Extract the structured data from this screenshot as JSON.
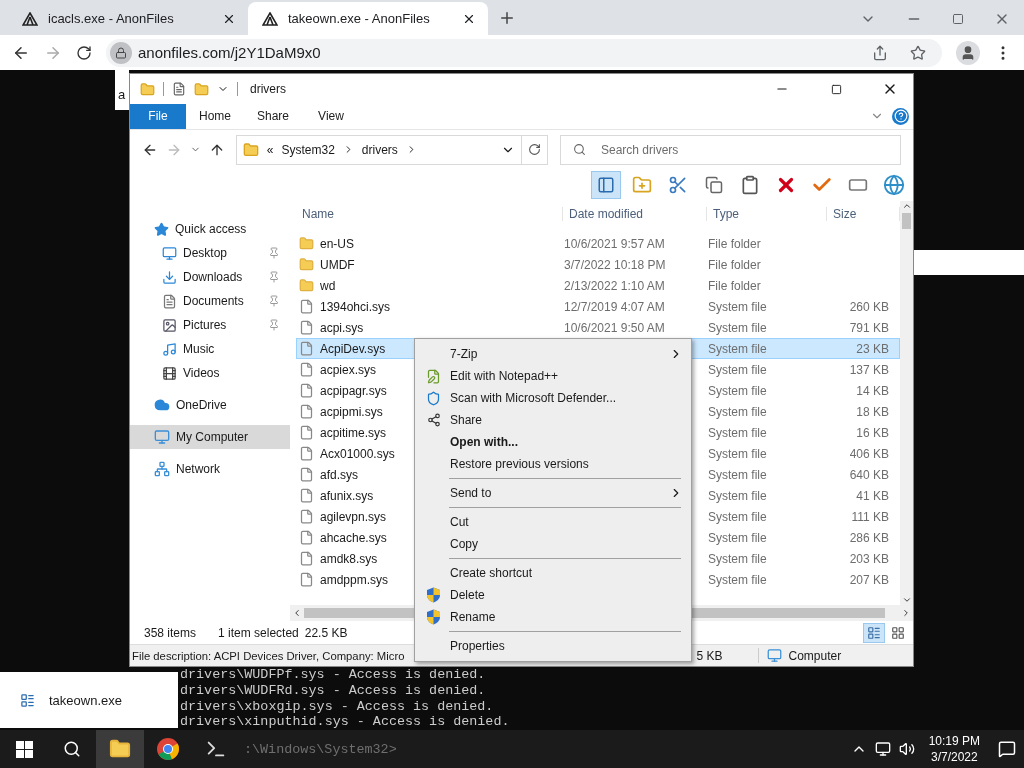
{
  "browser": {
    "tabs": [
      {
        "title": "icacls.exe - AnonFiles",
        "selected": false
      },
      {
        "title": "takeown.exe - AnonFiles",
        "selected": true
      }
    ],
    "url": "anonfiles.com/j2Y1DaM9x0"
  },
  "page_popup": {
    "text": "a"
  },
  "explorer": {
    "title": "drivers",
    "ribbon_tabs": [
      {
        "label": "File",
        "kind": "file"
      },
      {
        "label": "Home",
        "kind": "tab"
      },
      {
        "label": "Share",
        "kind": "tab"
      },
      {
        "label": "View",
        "kind": "tab"
      }
    ],
    "breadcrumb_overflow": "«",
    "breadcrumb": [
      "System32",
      "drivers"
    ],
    "search": {
      "placeholder": "Search drivers"
    },
    "toolbar": [
      {
        "kind": "pane",
        "selected": true
      },
      {
        "kind": "new-folder",
        "selected": false
      },
      {
        "kind": "cut",
        "selected": false
      },
      {
        "kind": "copy",
        "selected": false
      },
      {
        "kind": "paste",
        "selected": false
      },
      {
        "kind": "delete",
        "selected": false
      },
      {
        "kind": "check",
        "selected": false
      },
      {
        "kind": "rename",
        "selected": false
      },
      {
        "kind": "globe",
        "selected": false
      }
    ],
    "nav": [
      {
        "label": "Quick access",
        "kind": "star",
        "selected": false,
        "children": [
          {
            "label": "Desktop",
            "kind": "desktop",
            "pinned": true,
            "selected": false
          },
          {
            "label": "Downloads",
            "kind": "download",
            "pinned": true,
            "selected": false
          },
          {
            "label": "Documents",
            "kind": "document",
            "pinned": true,
            "selected": false
          },
          {
            "label": "Pictures",
            "kind": "pictures",
            "pinned": true,
            "selected": false
          },
          {
            "label": "Music",
            "kind": "music",
            "pinned": false,
            "selected": false
          },
          {
            "label": "Videos",
            "kind": "videos",
            "pinned": false,
            "selected": false
          }
        ]
      },
      {
        "label": "OneDrive",
        "kind": "cloud",
        "selected": false
      },
      {
        "label": "My Computer",
        "kind": "computer",
        "selected": true
      },
      {
        "label": "Network",
        "kind": "network",
        "selected": false
      }
    ],
    "columns": [
      "Name",
      "Date modified",
      "Type",
      "Size"
    ],
    "rows": [
      {
        "kind": "folder",
        "name": "en-US",
        "date": "10/6/2021 9:57 AM",
        "type": "File folder",
        "selected": false
      },
      {
        "kind": "folder",
        "name": "UMDF",
        "date": "3/7/2022 10:18 PM",
        "type": "File folder",
        "selected": false
      },
      {
        "kind": "folder",
        "name": "wd",
        "date": "2/13/2022 1:10 AM",
        "type": "File folder",
        "selected": false
      },
      {
        "kind": "file",
        "name": "1394ohci.sys",
        "date": "12/7/2019 4:07 AM",
        "type": "System file",
        "size": "260 KB",
        "selected": false
      },
      {
        "kind": "file",
        "name": "acpi.sys",
        "date": "10/6/2021 9:50 AM",
        "type": "System file",
        "size": "791 KB",
        "selected": false
      },
      {
        "kind": "file",
        "name": "AcpiDev.sys",
        "type": "System file",
        "size": "23 KB",
        "selected": true
      },
      {
        "kind": "file",
        "name": "acpiex.sys",
        "type": "System file",
        "size": "137 KB",
        "selected": false
      },
      {
        "kind": "file",
        "name": "acpipagr.sys",
        "type": "System file",
        "size": "14 KB",
        "selected": false
      },
      {
        "kind": "file",
        "name": "acpipmi.sys",
        "type": "System file",
        "size": "18 KB",
        "selected": false
      },
      {
        "kind": "file",
        "name": "acpitime.sys",
        "type": "System file",
        "size": "16 KB",
        "selected": false
      },
      {
        "kind": "file",
        "name": "Acx01000.sys",
        "type": "System file",
        "size": "406 KB",
        "selected": false
      },
      {
        "kind": "file",
        "name": "afd.sys",
        "type": "System file",
        "size": "640 KB",
        "selected": false
      },
      {
        "kind": "file",
        "name": "afunix.sys",
        "type": "System file",
        "size": "41 KB",
        "selected": false
      },
      {
        "kind": "file",
        "name": "agilevpn.sys",
        "type": "System file",
        "size": "111 KB",
        "selected": false
      },
      {
        "kind": "file",
        "name": "ahcache.sys",
        "type": "System file",
        "size": "286 KB",
        "selected": false
      },
      {
        "kind": "file",
        "name": "amdk8.sys",
        "type": "System file",
        "size": "203 KB",
        "selected": false
      },
      {
        "kind": "file",
        "name": "amdppm.sys",
        "type": "System file",
        "size": "207 KB",
        "selected": false
      }
    ],
    "status": {
      "count": "358 items",
      "selection": "1 item selected",
      "size": "22.5 KB"
    },
    "views": [
      {
        "kind": "details",
        "selected": true
      },
      {
        "kind": "large-icons",
        "selected": false
      }
    ],
    "details": {
      "description": "File description: ACPI Devices Driver, Company: Micro",
      "size": "5 KB",
      "location": "Computer"
    },
    "context_menu": [
      {
        "kind": "item",
        "label": "7-Zip",
        "submenu": true
      },
      {
        "kind": "notepad",
        "label": "Edit with Notepad++"
      },
      {
        "kind": "defender",
        "label": "Scan with Microsoft Defender..."
      },
      {
        "kind": "share",
        "label": "Share"
      },
      {
        "kind": "item",
        "label": "Open with...",
        "bold": true
      },
      {
        "kind": "item",
        "label": "Restore previous versions"
      },
      {
        "kind": "separator"
      },
      {
        "kind": "item",
        "label": "Send to",
        "submenu": true
      },
      {
        "kind": "separator"
      },
      {
        "kind": "item",
        "label": "Cut"
      },
      {
        "kind": "item",
        "label": "Copy"
      },
      {
        "kind": "separator"
      },
      {
        "kind": "item",
        "label": "Create shortcut"
      },
      {
        "kind": "uac",
        "label": "Delete"
      },
      {
        "kind": "uac",
        "label": "Rename"
      },
      {
        "kind": "separator"
      },
      {
        "kind": "item",
        "label": "Properties"
      }
    ]
  },
  "console": {
    "lines": [
      "drivers\\WUDFPf.sys - Access is denied.",
      "drivers\\WUDFRd.sys - Access is denied.",
      "drivers\\xboxgip.sys - Access is denied.",
      "drivers\\xinputhid.sys - Access is denied."
    ],
    "prompt": ":\\Windows\\System32>"
  },
  "notification": {
    "title": "takeown.exe"
  },
  "taskbar": {
    "apps": [
      {
        "kind": "explorer",
        "active": true
      },
      {
        "kind": "chrome",
        "active": false
      },
      {
        "kind": "terminal",
        "active": false
      }
    ],
    "time": "10:19 PM",
    "date": "3/7/2022"
  }
}
